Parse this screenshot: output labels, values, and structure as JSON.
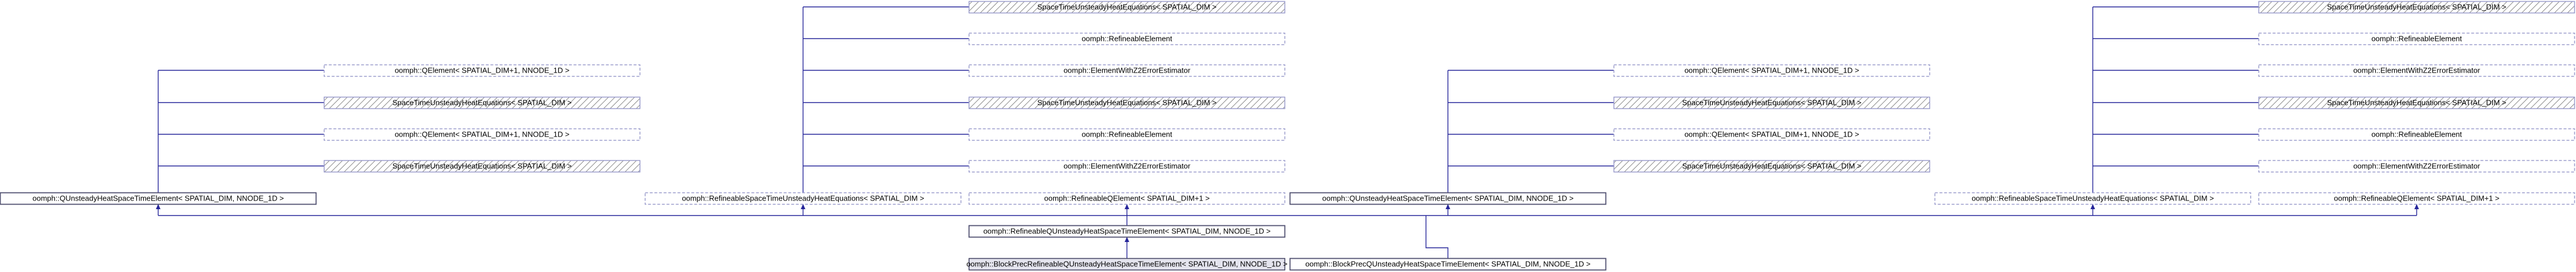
{
  "labels": {
    "spacetime_eq": "SpaceTimeUnsteadyHeatEquations< SPATIAL_DIM >",
    "refineable_element": "oomph::RefineableElement",
    "error_estimator": "oomph::ElementWithZ2ErrorEstimator",
    "qelement": "oomph::QElement< SPATIAL_DIM+1, NNODE_1D >",
    "q_unsteady": "oomph::QUnsteadyHeatSpaceTimeElement< SPATIAL_DIM, NNODE_1D >",
    "refineable_eq": "oomph::RefineableSpaceTimeUnsteadyHeatEquations< SPATIAL_DIM >",
    "refineable_qelement": "oomph::RefineableQElement< SPATIAL_DIM+1 >",
    "refineable_q_unsteady": "oomph::RefineableQUnsteadyHeatSpaceTimeElement< SPATIAL_DIM, NNODE_1D >",
    "block_prec_1": "oomph::BlockPrecRefineableQUnsteadyHeatSpaceTimeElement< SPATIAL_DIM, NNODE_1D >",
    "block_prec_2": "oomph::BlockPrecQUnsteadyHeatSpaceTimeElement< SPATIAL_DIM, NNODE_1D >"
  },
  "colors": {
    "edge": "#26269a",
    "node_border": "#9a9ccc",
    "current_fill": "#e4e4ee"
  }
}
